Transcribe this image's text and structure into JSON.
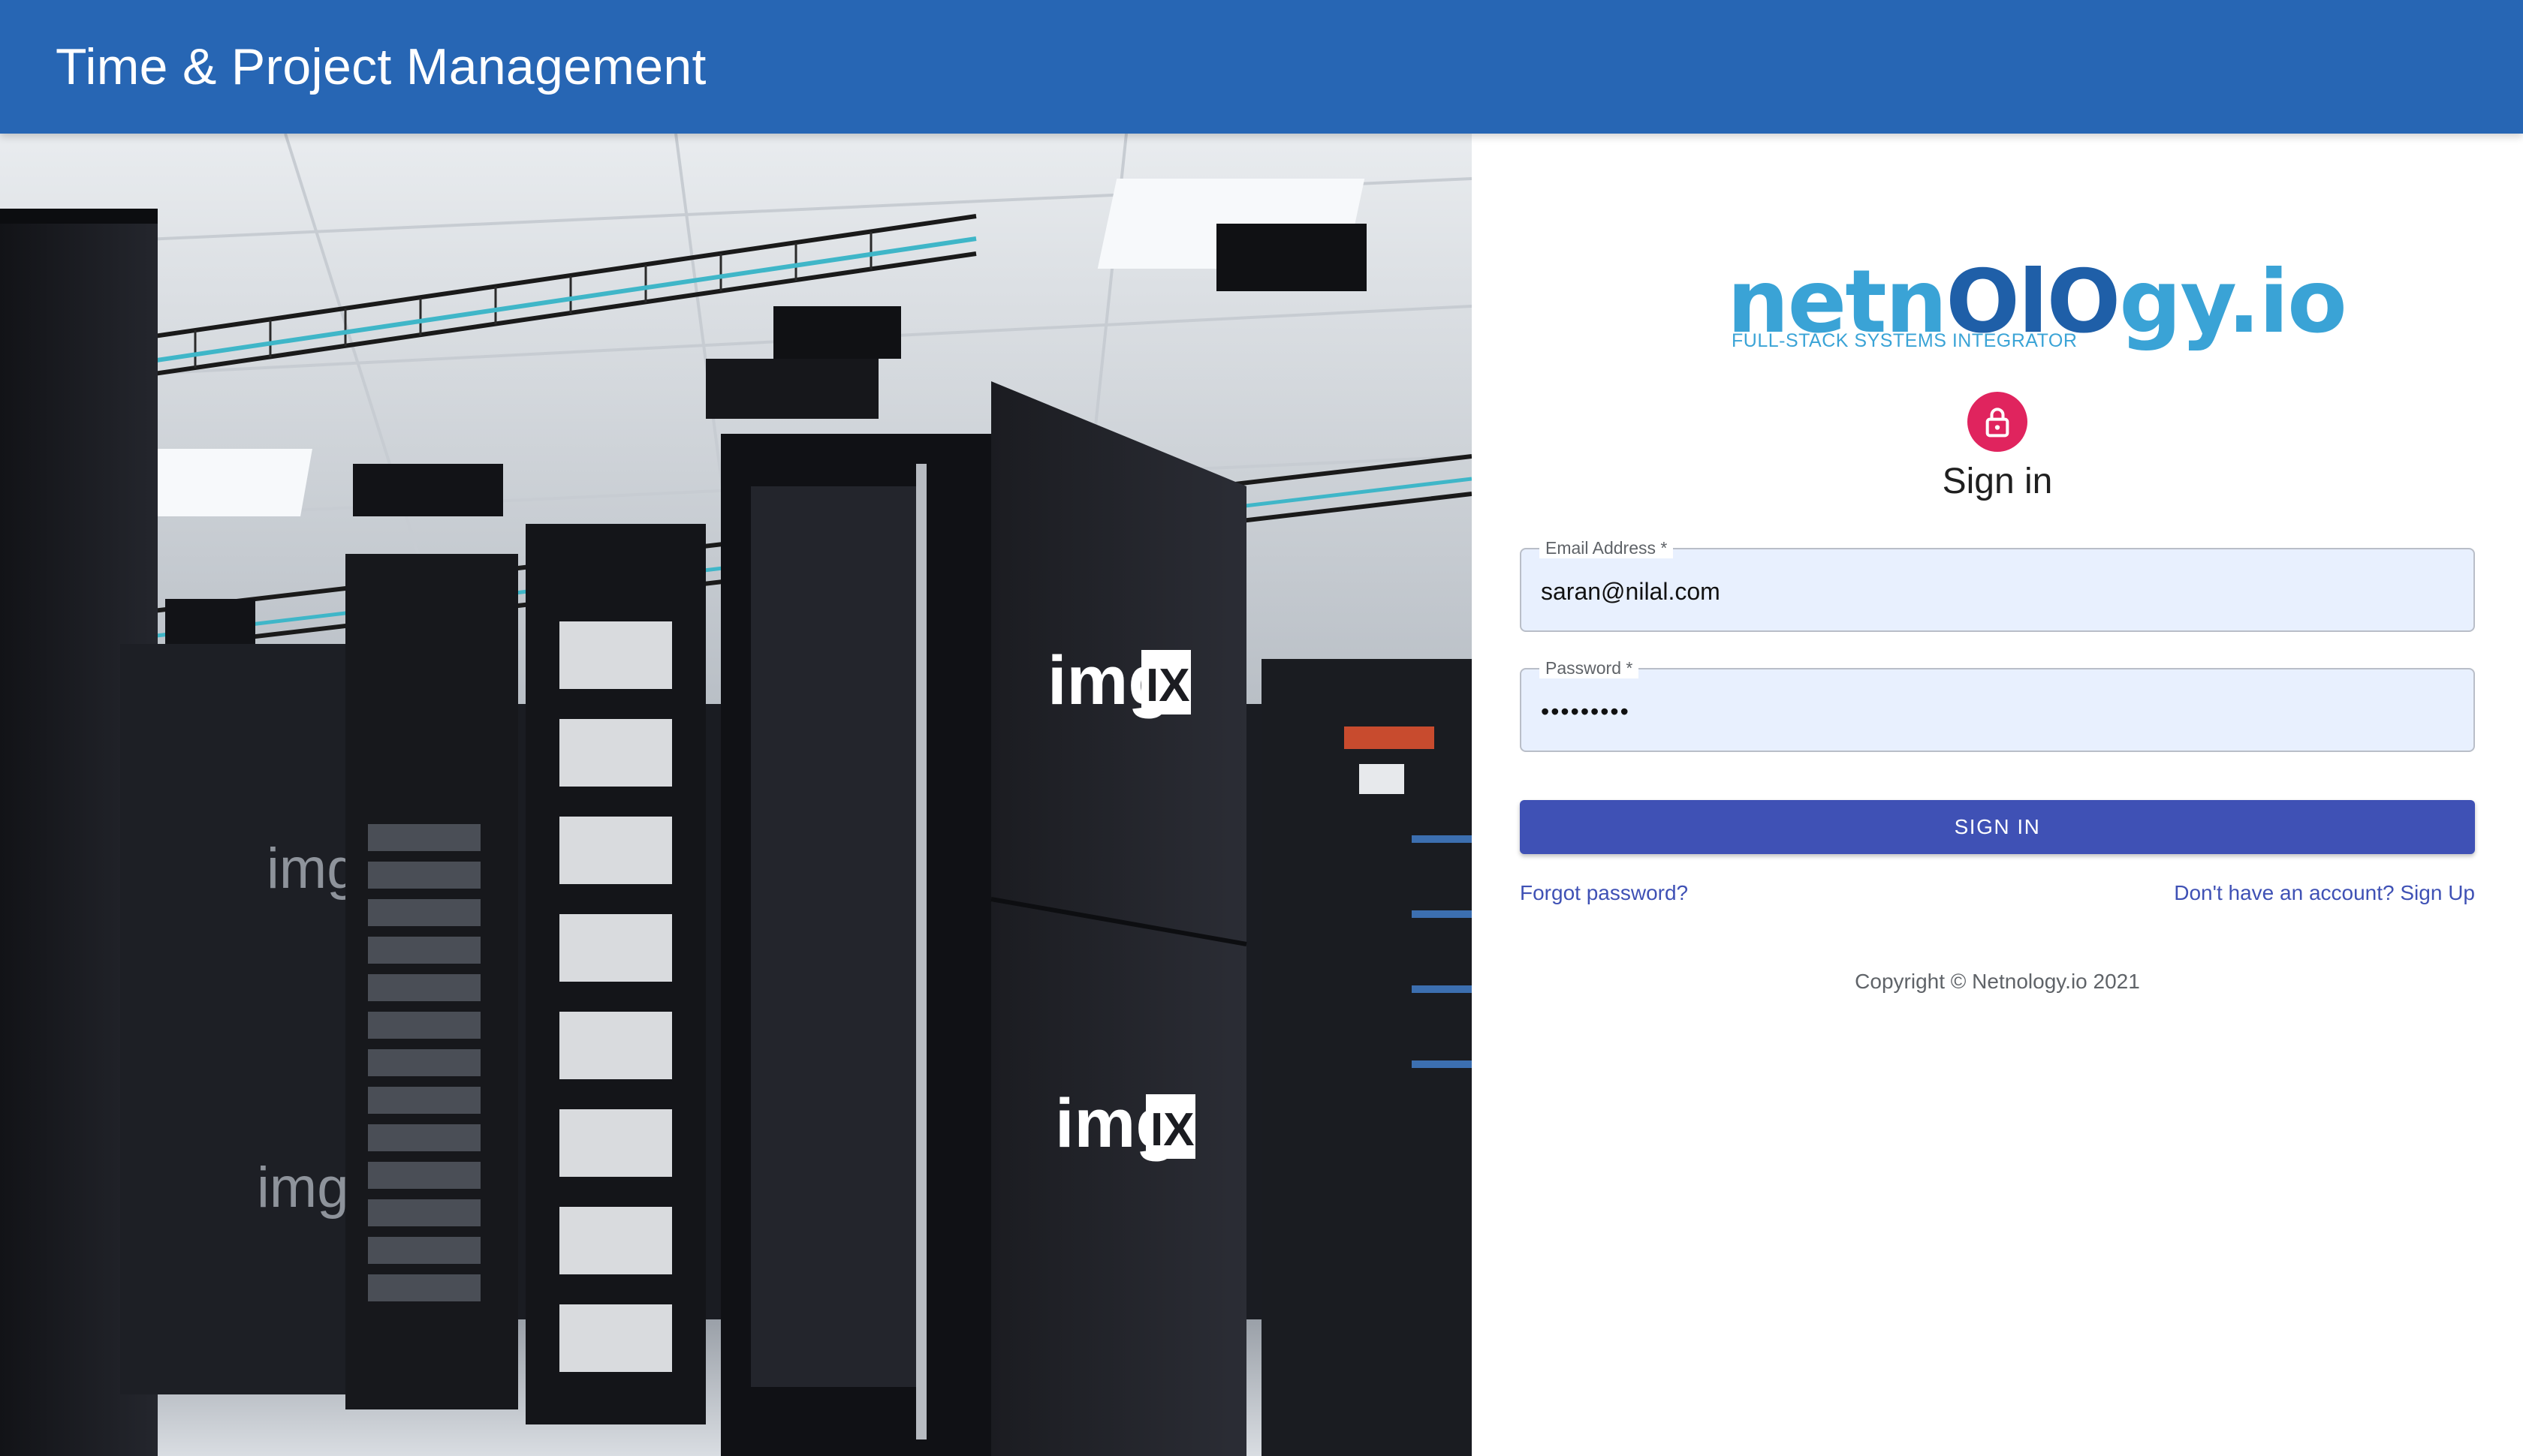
{
  "appbar": {
    "title": "Time & Project Management",
    "color": "#2766b4"
  },
  "hero": {
    "image": "server-room-photo",
    "rack_labels": [
      "img",
      "IX",
      "img",
      "IX",
      "img",
      "img"
    ]
  },
  "brand": {
    "logo_prefix": "netn",
    "logo_dark": "OlO",
    "logo_suffix": "gy.io",
    "tagline": "FULL-STACK SYSTEMS INTEGRATOR",
    "colors": {
      "light": "#3aa3d6",
      "dark": "#1f5fa8"
    }
  },
  "signin": {
    "icon": "lock-icon",
    "title": "Sign in",
    "email": {
      "label": "Email Address *",
      "value": "saran@nilal.com"
    },
    "password": {
      "label": "Password *",
      "value": "•••••••••"
    },
    "button_label": "SIGN IN",
    "forgot_link": "Forgot password?",
    "signup_link": "Don't have an account? Sign Up",
    "copyright": "Copyright © Netnology.io 2021",
    "colors": {
      "primary": "#3f51b5",
      "avatar": "#e0245e",
      "autofill": "#e8f0fe"
    }
  }
}
